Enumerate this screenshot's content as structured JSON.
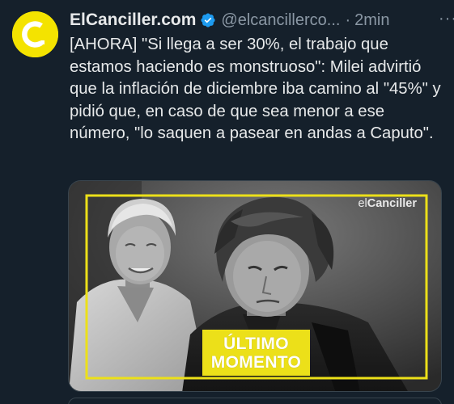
{
  "tweet": {
    "display_name": "ElCanciller.com",
    "handle": "@elcancillerco...",
    "separator": "·",
    "time": "2min",
    "more_label": "···",
    "text": "[AHORA] \"Si llega a ser 30%, el trabajo que estamos haciendo es monstruoso\": Milei advirtió que la inflación de diciembre iba camino al \"45%\" y pidió que, en caso de que sea menor a ese número, \"lo saquen a pasear en andas a Caputo\".",
    "avatar_icon": "elcanciller-logo-icon",
    "verified_icon": "verified-badge-icon"
  },
  "media": {
    "brand_prefix": "el",
    "brand_name": "Canciller",
    "badge_line1": "ÚLTIMO",
    "badge_line2": "MOMENTO"
  },
  "colors": {
    "background": "#15202b",
    "text": "#e7e9ea",
    "secondary_text": "#8b98a5",
    "verified": "#1d9bf0",
    "brand_yellow": "#ece019"
  }
}
